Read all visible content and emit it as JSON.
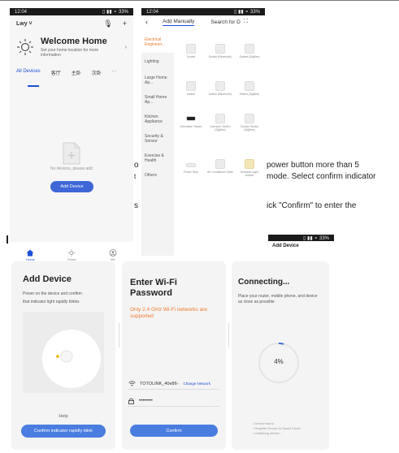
{
  "screen1": {
    "status_time": "12:04",
    "status_right": "▯ ▮▮ ⚬ 33%",
    "home_name": "Lwy ˅",
    "welcome_title": "Welcome Home",
    "welcome_sub": "Set your home location for more information",
    "tabs": [
      "All Devices",
      "客厅",
      "主卧",
      "次卧",
      "···"
    ],
    "empty_text": "No devices, please add",
    "add_button": "Add Device",
    "nav": [
      "Home",
      "Smart",
      "Me"
    ]
  },
  "screen2": {
    "status_time": "12:04",
    "status_right": "▯ ▮▮ ⚬ 33%",
    "tab_manual": "Add Manually",
    "tab_scan": "Search for D",
    "categories": [
      "Electrical Engineeri...",
      "Lighting",
      "Large Home Ap...",
      "Small Home Ap...",
      "Kitchen Appliance",
      "Security & Sensor",
      "Exercise & Health",
      "Others"
    ],
    "devices": [
      "Socket",
      "Socket (Bluetooth)",
      "Socket (ZigBee)",
      "Switch",
      "Switch (Bluetooth)",
      "Switch (ZigBee)",
      "Dimmable Switch",
      "Scenario Switch (ZigBee)",
      "Curtain Switch (ZigBee)",
      "Power Strip",
      "Air Conditioner Mate",
      "Scenario Light Socket"
    ]
  },
  "fragments": {
    "f1": "power button more than 5",
    "f1_left": "o",
    "f2": "mode. Select confirm indicator",
    "f2_left": "t",
    "f3": "ick \"Confirm\" to enter the",
    "f3_left": "s"
  },
  "screen3_status": "▯ ▮▮ ⚬ 33%",
  "screen3_header": "Add Device",
  "bottom1": {
    "title": "Add Device",
    "desc1": "Power on the device and confirm",
    "desc2": "that indicator light rapidly blinks",
    "help": "Help",
    "button": "Confirm indicator rapidly blink"
  },
  "bottom2": {
    "title": "Enter Wi-Fi Password",
    "warning": "Only 2.4 GHz Wi-Fi networks are supported",
    "ssid": "TOTOLINK_40e86-",
    "change": "Change Network",
    "password": "••••••••",
    "button": "Confirm"
  },
  "bottom3": {
    "title": "Connecting...",
    "desc": "Place your router, mobile phone, and device as close as possible",
    "percent": "4%",
    "progress": 0.04,
    "steps": [
      "• Device found",
      "• Register Device to Smart Cloud",
      "• Initializing device..."
    ]
  }
}
